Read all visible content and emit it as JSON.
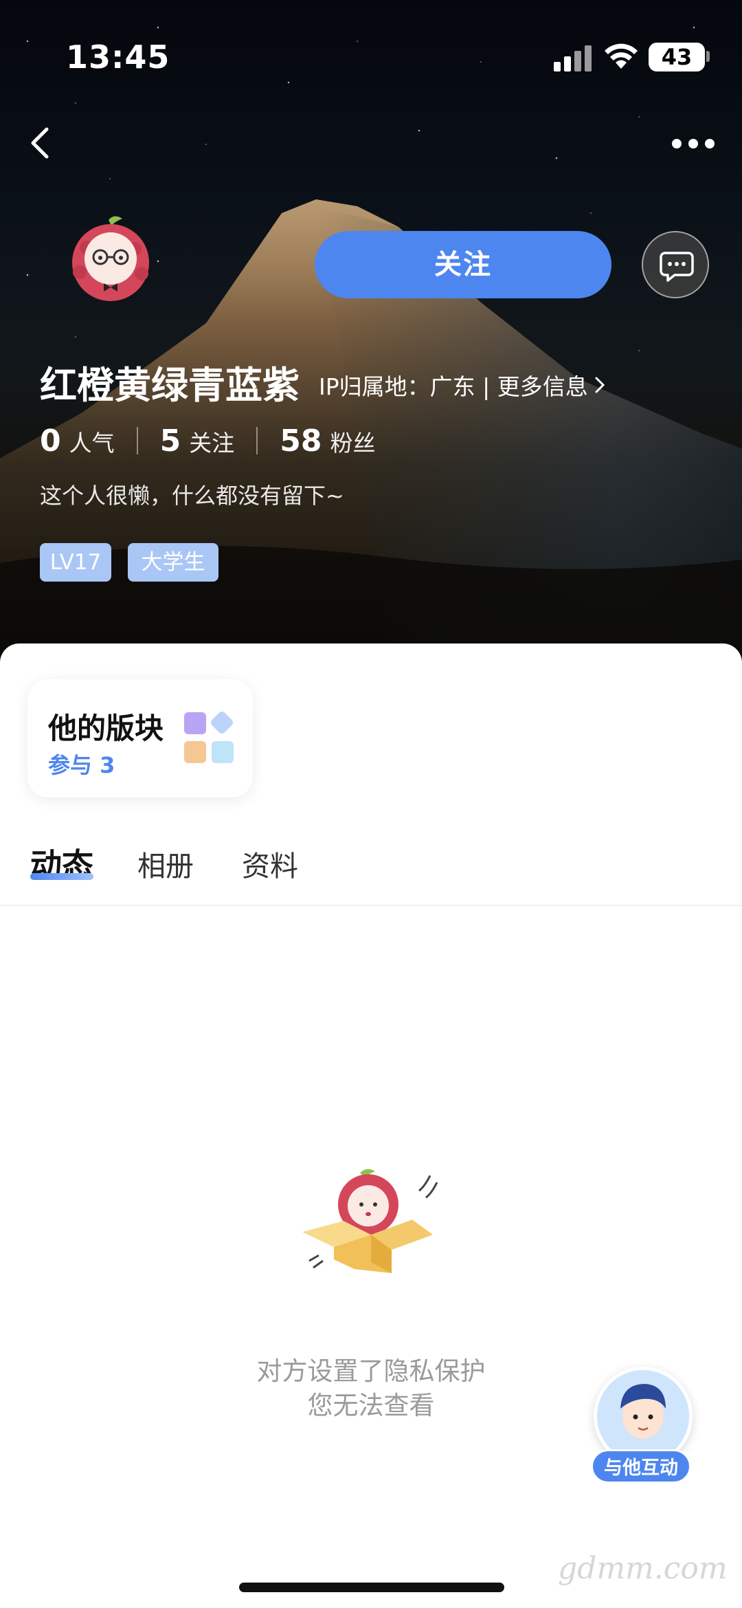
{
  "status_bar": {
    "time": "13:45",
    "battery": "43"
  },
  "profile": {
    "username": "红橙黄绿青蓝紫",
    "ip_label": "IP归属地：广东 | 更多信息",
    "follow_label": "关注",
    "stats": [
      {
        "value": "0",
        "label": "人气"
      },
      {
        "value": "5",
        "label": "关注"
      },
      {
        "value": "58",
        "label": "粉丝"
      }
    ],
    "bio": "这个人很懒，什么都没有留下~",
    "tags": [
      "LV17",
      "大学生"
    ]
  },
  "board": {
    "title": "他的版块",
    "subtitle": "参与 3"
  },
  "tabs": [
    {
      "label": "动态",
      "active": true
    },
    {
      "label": "相册",
      "active": false
    },
    {
      "label": "资料",
      "active": false
    }
  ],
  "empty_state": {
    "line1": "对方设置了隐私保护",
    "line2": "您无法查看"
  },
  "interact": {
    "label": "与他互动"
  },
  "watermark": "gdmm.com",
  "colors": {
    "accent": "#4e86f0",
    "tag_bg": "#a9c6f5",
    "muted_text": "#9a9a9a"
  }
}
